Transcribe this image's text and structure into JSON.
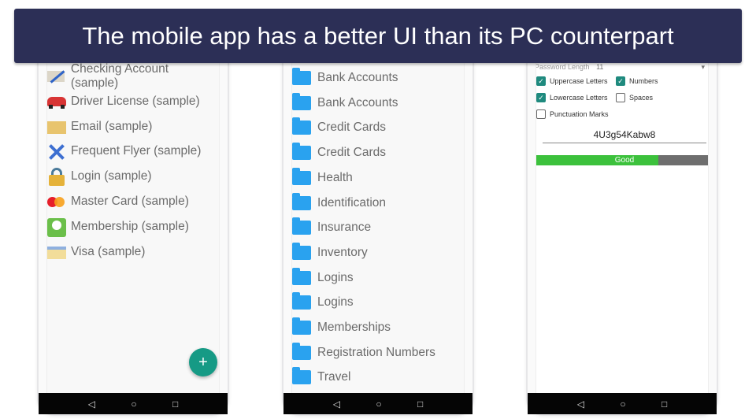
{
  "banner": {
    "title": "The mobile app has a better UI than its PC counterpart"
  },
  "left_phone": {
    "items": [
      {
        "label": "Checking Account (sample)",
        "icon": "pen-icon"
      },
      {
        "label": "Driver License (sample)",
        "icon": "car-icon"
      },
      {
        "label": "Email (sample)",
        "icon": "envelope-icon"
      },
      {
        "label": "Frequent Flyer (sample)",
        "icon": "plane-icon"
      },
      {
        "label": "Login (sample)",
        "icon": "padlock-icon"
      },
      {
        "label": "Master Card (sample)",
        "icon": "mastercard-icon"
      },
      {
        "label": "Membership (sample)",
        "icon": "golf-icon"
      },
      {
        "label": "Visa (sample)",
        "icon": "card-icon"
      }
    ],
    "fab": "+"
  },
  "middle_phone": {
    "folders": [
      "Bank Accounts",
      "Bank Accounts",
      "Credit Cards",
      "Credit Cards",
      "Health",
      "Identification",
      "Insurance",
      "Inventory",
      "Logins",
      "Logins",
      "Memberships",
      "Registration Numbers",
      "Travel"
    ]
  },
  "right_phone": {
    "length_label": "Password Length",
    "length_value": "11",
    "options": [
      {
        "label": "Uppercase Letters",
        "checked": true
      },
      {
        "label": "Numbers",
        "checked": true
      },
      {
        "label": "Lowercase Letters",
        "checked": true
      },
      {
        "label": "Spaces",
        "checked": false
      },
      {
        "label": "Punctuation Marks",
        "checked": false
      }
    ],
    "password": "4U3g54Kabw8",
    "strength_label": "Good",
    "strength_percent": 69,
    "strength_color": "#3cc13c"
  },
  "navbar": {
    "back": "◁",
    "home": "○",
    "recents": "□"
  }
}
